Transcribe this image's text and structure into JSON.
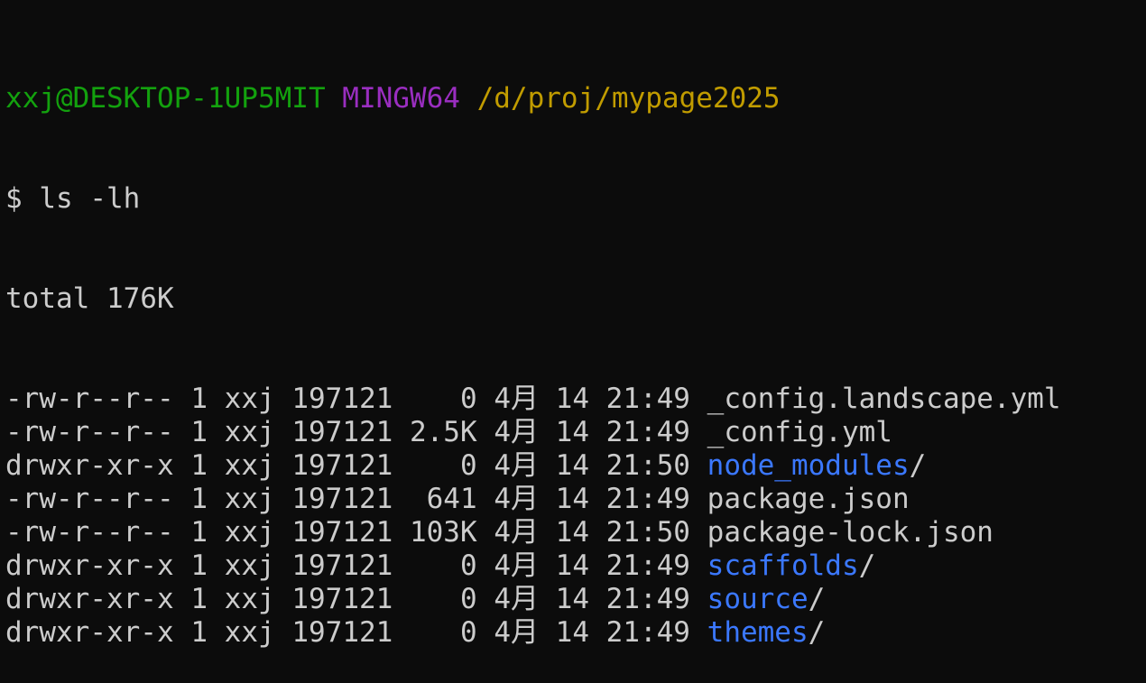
{
  "prompt": {
    "user_host": "xxj@DESKTOP-1UP5MIT",
    "shell": "MINGW64",
    "path": "/d/proj/mypage2025"
  },
  "command": {
    "symbol": "$",
    "text": "ls -lh"
  },
  "total": "total 176K",
  "listing": [
    {
      "perms": "-rw-r--r--",
      "links": "1",
      "owner": "xxj",
      "group": "197121",
      "size": "0",
      "month": "4月",
      "day": "14",
      "time": "21:49",
      "name": "_config.landscape.yml",
      "is_dir": false,
      "suffix": ""
    },
    {
      "perms": "-rw-r--r--",
      "links": "1",
      "owner": "xxj",
      "group": "197121",
      "size": "2.5K",
      "month": "4月",
      "day": "14",
      "time": "21:49",
      "name": "_config.yml",
      "is_dir": false,
      "suffix": ""
    },
    {
      "perms": "drwxr-xr-x",
      "links": "1",
      "owner": "xxj",
      "group": "197121",
      "size": "0",
      "month": "4月",
      "day": "14",
      "time": "21:50",
      "name": "node_modules",
      "is_dir": true,
      "suffix": "/"
    },
    {
      "perms": "-rw-r--r--",
      "links": "1",
      "owner": "xxj",
      "group": "197121",
      "size": "641",
      "month": "4月",
      "day": "14",
      "time": "21:49",
      "name": "package.json",
      "is_dir": false,
      "suffix": ""
    },
    {
      "perms": "-rw-r--r--",
      "links": "1",
      "owner": "xxj",
      "group": "197121",
      "size": "103K",
      "month": "4月",
      "day": "14",
      "time": "21:50",
      "name": "package-lock.json",
      "is_dir": false,
      "suffix": ""
    },
    {
      "perms": "drwxr-xr-x",
      "links": "1",
      "owner": "xxj",
      "group": "197121",
      "size": "0",
      "month": "4月",
      "day": "14",
      "time": "21:49",
      "name": "scaffolds",
      "is_dir": true,
      "suffix": "/"
    },
    {
      "perms": "drwxr-xr-x",
      "links": "1",
      "owner": "xxj",
      "group": "197121",
      "size": "0",
      "month": "4月",
      "day": "14",
      "time": "21:49",
      "name": "source",
      "is_dir": true,
      "suffix": "/"
    },
    {
      "perms": "drwxr-xr-x",
      "links": "1",
      "owner": "xxj",
      "group": "197121",
      "size": "0",
      "month": "4月",
      "day": "14",
      "time": "21:49",
      "name": "themes",
      "is_dir": true,
      "suffix": "/"
    }
  ],
  "colors": {
    "background": "#0c0c0c",
    "foreground": "#cccccc",
    "user_host": "#13a10e",
    "shell": "#9a2ec0",
    "path": "#c19c00",
    "directory": "#3b78ff"
  }
}
